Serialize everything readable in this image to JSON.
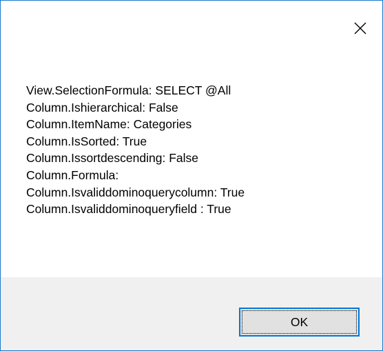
{
  "dialog": {
    "close_icon": "close-icon",
    "message_lines": [
      "View.SelectionFormula: SELECT @All",
      "Column.Ishierarchical: False",
      "Column.ItemName: Categories",
      "Column.IsSorted: True",
      "Column.Issortdescending: False",
      "Column.Formula: ",
      "Column.Isvaliddominoquerycolumn: True",
      "Column.Isvaliddominoqueryfield : True"
    ],
    "ok_label": "OK"
  },
  "colors": {
    "border": "#1979ca",
    "footer": "#f0f0f0",
    "button_face": "#e1e1e1",
    "button_focus": "#0078d7"
  }
}
